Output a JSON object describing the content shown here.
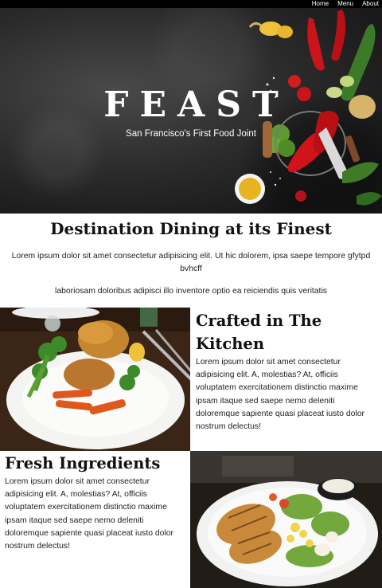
{
  "nav": {
    "items": [
      "Home",
      "Menu",
      "About"
    ]
  },
  "hero": {
    "title": "FEAST",
    "subtitle": "San Francisco's First Food Joint"
  },
  "intro": {
    "heading": "Destination Dining at its Finest",
    "paragraph1": "Lorem ipsum dolor sit amet consectetur adipisicing elit. Ut hic dolorem, ipsa saepe tempore gfytpd bvhcff",
    "paragraph2": "laboriosam doloribus adipisci illo inventore optio ea reiciendis quis veritatis"
  },
  "features": [
    {
      "title": "Crafted in The Kitchen",
      "body": "Lorem ipsum dolor sit amet consectetur adipisicing elit. A, molestias? At, officiis voluptatem exercitationem distinctio maxime ipsam itaque sed saepe nemo deleniti doloremque sapiente quasi placeat iusto dolor nostrum delectus!",
      "image": "roast-dinner-plate-photo"
    },
    {
      "title": "Fresh Ingredients",
      "body": "Lorem ipsum dolor sit amet consectetur adipisicing elit. A, molestias? At, officiis voluptatem exercitationem distinctio maxime ipsam itaque sed saepe nemo deleniti doloremque sapiente quasi placeat iusto dolor nostrum delectus!",
      "image": "chicken-salad-bowl-photo"
    }
  ],
  "colors": {
    "nav_bg": "#000000",
    "hero_bg": "#2c2c2c",
    "text": "#222222",
    "pepper_red": "#c8141a",
    "leaf_green": "#3f8a2a"
  }
}
